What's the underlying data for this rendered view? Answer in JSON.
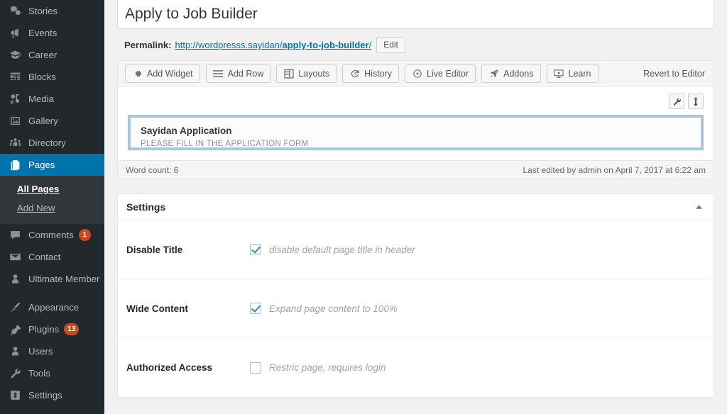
{
  "sidebar": {
    "items": [
      {
        "label": "Stories",
        "icon": "comments-bubbles-icon",
        "badge": null,
        "current": false
      },
      {
        "label": "Events",
        "icon": "megaphone-icon",
        "badge": null,
        "current": false
      },
      {
        "label": "Career",
        "icon": "graduation-cap-icon",
        "badge": null,
        "current": false
      },
      {
        "label": "Blocks",
        "icon": "blocks-grid-icon",
        "badge": null,
        "current": false
      },
      {
        "label": "Media",
        "icon": "media-icon",
        "badge": null,
        "current": false
      },
      {
        "label": "Gallery",
        "icon": "image-icon",
        "badge": null,
        "current": false
      },
      {
        "label": "Directory",
        "icon": "group-people-icon",
        "badge": null,
        "current": false
      },
      {
        "label": "Pages",
        "icon": "pages-icon",
        "badge": null,
        "current": true
      },
      {
        "label": "Comments",
        "icon": "comment-icon",
        "badge": "1",
        "current": false
      },
      {
        "label": "Contact",
        "icon": "envelope-icon",
        "badge": null,
        "current": false
      },
      {
        "label": "Ultimate Member",
        "icon": "user-icon",
        "badge": null,
        "current": false
      },
      {
        "label": "Appearance",
        "icon": "paintbrush-icon",
        "badge": null,
        "current": false
      },
      {
        "label": "Plugins",
        "icon": "plug-icon",
        "badge": "13",
        "current": false
      },
      {
        "label": "Users",
        "icon": "user-icon",
        "badge": null,
        "current": false
      },
      {
        "label": "Tools",
        "icon": "wrench-icon",
        "badge": null,
        "current": false
      },
      {
        "label": "Settings",
        "icon": "sliders-icon",
        "badge": null,
        "current": false
      }
    ],
    "submenu": [
      {
        "label": "All Pages",
        "current": true
      },
      {
        "label": "Add New",
        "current": false
      }
    ],
    "colors": {
      "background": "#23282d",
      "submenu_background": "#32373c",
      "current_item": "#0073aa",
      "badge": "#ca4a1f",
      "text": "#b4b9be"
    }
  },
  "editor": {
    "title_value": "Apply to Job Builder",
    "title_placeholder": "Enter title here",
    "permalink": {
      "label": "Permalink:",
      "base": "http://wordpresss.sayidan/",
      "slug": "apply-to-job-builder",
      "trailing_slash": "/",
      "edit_button": "Edit",
      "link_color": "#0073aa"
    },
    "toolbar": {
      "buttons": [
        {
          "label": "Add Widget",
          "icon": "gear-icon"
        },
        {
          "label": "Add Row",
          "icon": "hamburger-rows-icon"
        },
        {
          "label": "Layouts",
          "icon": "layout-columns-icon"
        },
        {
          "label": "History",
          "icon": "history-clock-icon"
        },
        {
          "label": "Live Editor",
          "icon": "play-circle-icon"
        },
        {
          "label": "Addons",
          "icon": "rocket-icon"
        },
        {
          "label": "Learn",
          "icon": "presentation-board-icon"
        }
      ],
      "revert_label": "Revert to Editor"
    },
    "canvas_tools": [
      {
        "name": "wrench",
        "icon": "wrench-icon"
      },
      {
        "name": "move",
        "icon": "move-vertical-icon"
      }
    ],
    "widget": {
      "title": "Sayidan Application",
      "subtitle": "PLEASE FILL IN THE APPLICATION FORM",
      "border_color": "#a8c6dd"
    },
    "status": {
      "word_count": "Word count: 6",
      "last_edited": "Last edited by admin on April 7, 2017 at 6:22 am"
    }
  },
  "settings_panel": {
    "heading": "Settings",
    "toggle_icon": "triangle-up-icon",
    "rows": [
      {
        "label": "Disable Title",
        "description": "disable default page title in header",
        "checked": true
      },
      {
        "label": "Wide Content",
        "description": "Expand page content to 100%",
        "checked": true
      },
      {
        "label": "Authorized Access",
        "description": "Restric page, requires login",
        "checked": false
      }
    ],
    "checkbox_color": "#1e8cbe"
  }
}
